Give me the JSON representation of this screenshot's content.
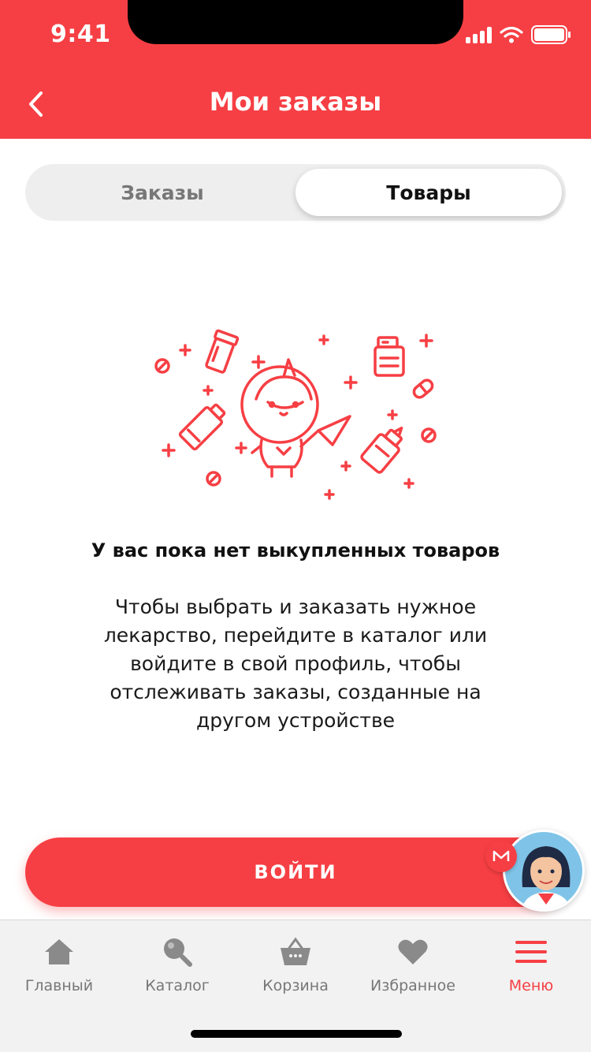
{
  "status_bar": {
    "time": "9:41",
    "icons": [
      "signal-icon",
      "wifi-icon",
      "battery-icon"
    ]
  },
  "header": {
    "title": "Мои заказы",
    "back_icon": "chevron-left-icon"
  },
  "segments": [
    {
      "label": "Заказы",
      "selected": false
    },
    {
      "label": "Товары",
      "selected": true
    }
  ],
  "empty_state": {
    "title": "У вас пока нет выкупленных товаров",
    "text": "Чтобы выбрать и заказать нужное лекарство, перейдите в каталог или войдите в свой профиль, чтобы отслеживать заказы, созданные на другом устройстве",
    "illustration": "unicorn-astronaut-with-medicines"
  },
  "login_button": {
    "label": "ВОЙТИ"
  },
  "assistant": {
    "icon": "assistant-avatar",
    "badge_icon": "brand-m-icon"
  },
  "tabbar": {
    "items": [
      {
        "label": "Главный",
        "icon": "home-icon",
        "active": false
      },
      {
        "label": "Каталог",
        "icon": "search-icon",
        "active": false
      },
      {
        "label": "Корзина",
        "icon": "basket-icon",
        "active": false
      },
      {
        "label": "Избранное",
        "icon": "heart-icon",
        "active": false
      },
      {
        "label": "Меню",
        "icon": "menu-icon",
        "active": true
      }
    ]
  },
  "colors": {
    "brand_red": "#f63f44",
    "inactive_gray": "#777777",
    "tabbar_bg": "#f2f2f2"
  }
}
